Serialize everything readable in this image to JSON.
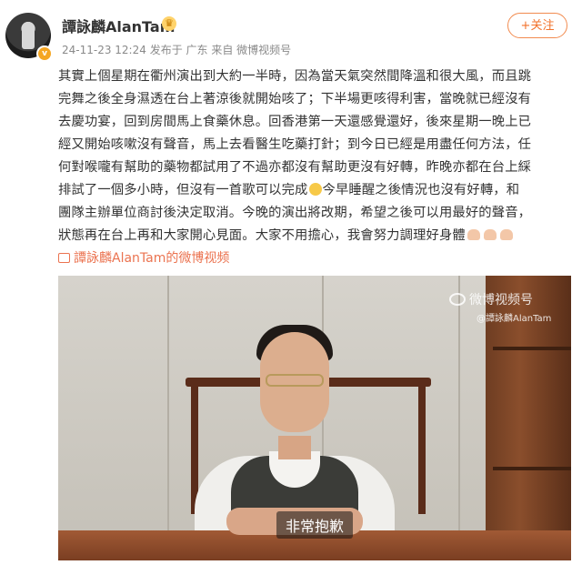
{
  "user": {
    "name": "譚詠麟AlanTam",
    "vip_icon": "crown-icon",
    "verified_icon": "verified-v-icon",
    "timestamp": "24-11-23 12:24",
    "source_text": "发布于 广东 来自 微博视频号",
    "follow_label": "+关注"
  },
  "post": {
    "lines": [
      "其實上個星期在衢州演出到大約一半時，因為當天氣突然間降溫和很大風，而且跳",
      "完舞之後全身濕透在台上著涼後就開始咳了；下半場更咳得利害，當晚就已經沒有",
      "去慶功宴，回到房間馬上食藥休息。回香港第一天還感覺還好，後來星期一晚上已",
      "經又開始咳嗽沒有聲音，馬上去看醫生吃藥打針；到今日已經是用盡任何方法，任",
      "何對喉嚨有幫助的藥物都試用了不過亦都沒有幫助更沒有好轉，昨晚亦都在台上綵",
      "排試了一個多小時，但沒有一首歌可以完成",
      "今早睡醒之後情況也沒有好轉，和",
      "團隊主辦單位商討後決定取消。今晚的演出將改期，希望之後可以用最好的聲音，",
      "狀態再在台上再和大家開心見面。大家不用擔心，我會努力調理好身體"
    ]
  },
  "video_link": {
    "icon": "video-link-icon",
    "text": "譚詠麟AlanTam的微博视频"
  },
  "video": {
    "watermark_logo": "weibo-logo-icon",
    "watermark_title": "微博视频号",
    "watermark_user": "@譚詠麟AlanTam",
    "subtitle": "非常抱歉"
  }
}
